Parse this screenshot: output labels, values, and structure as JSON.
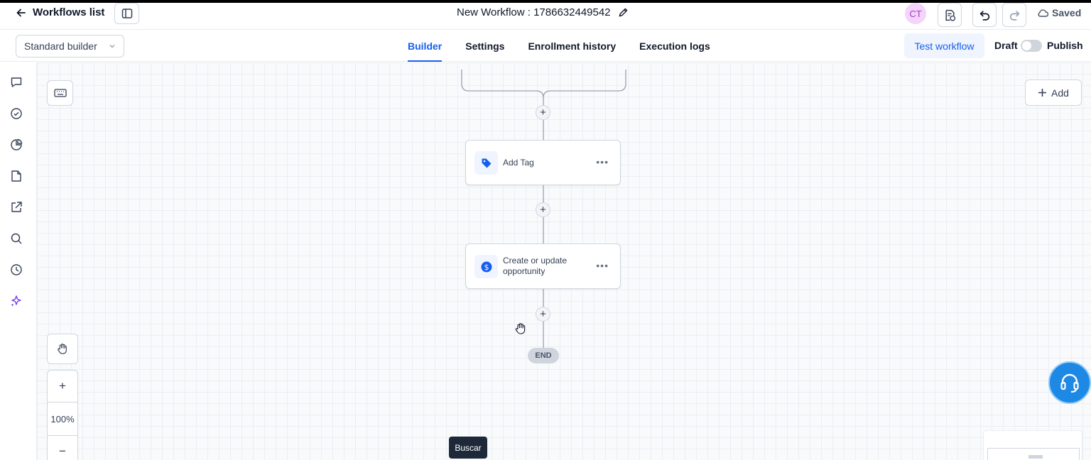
{
  "header": {
    "back_label": "Workflows list",
    "workflow_title": "New Workflow : 1786632449542",
    "avatar_initials": "CT",
    "saved_label": "Saved"
  },
  "toolbar": {
    "builder_mode": "Standard builder",
    "tabs": [
      {
        "label": "Builder",
        "active": true
      },
      {
        "label": "Settings",
        "active": false
      },
      {
        "label": "Enrollment history",
        "active": false
      },
      {
        "label": "Execution logs",
        "active": false
      }
    ],
    "test_label": "Test workflow",
    "draft_label": "Draft",
    "publish_label": "Publish",
    "published": false
  },
  "sidebar": {
    "icons": [
      "chat-icon",
      "check-circle-icon",
      "pie-chart-icon",
      "document-icon",
      "external-link-icon",
      "search-icon",
      "history-icon",
      "sparkle-icon"
    ]
  },
  "canvas": {
    "add_label": "Add",
    "nodes": [
      {
        "label": "Add Tag",
        "icon": "tag-icon"
      },
      {
        "label": "Create or update opportunity",
        "icon": "dollar-icon"
      }
    ],
    "end_label": "END",
    "zoom_level": "100%",
    "tooltip": "Buscar"
  },
  "colors": {
    "accent": "#155eef",
    "node_icon": "#155eef",
    "sparkle": "#7a3cf0",
    "support": "#1e88e5"
  }
}
